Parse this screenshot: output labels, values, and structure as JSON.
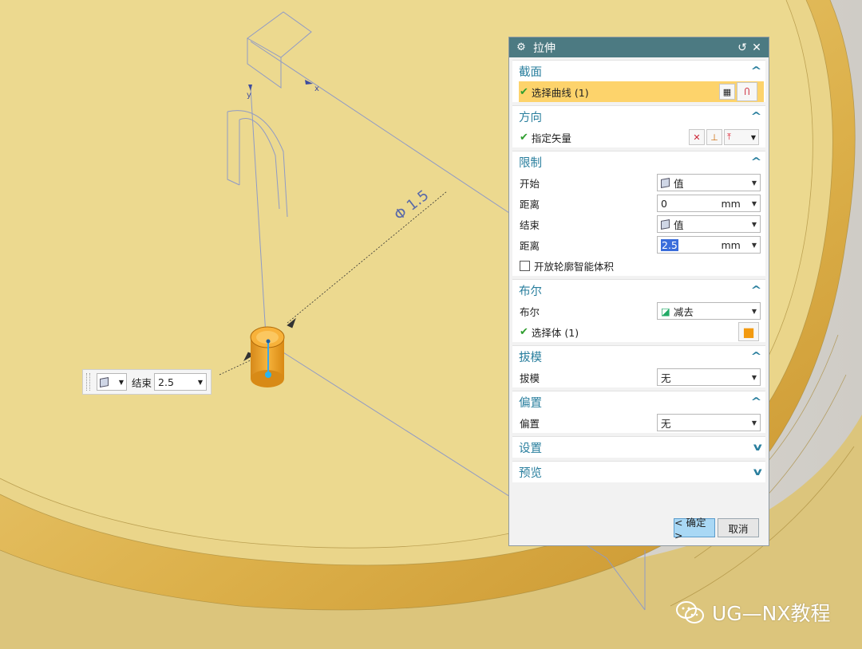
{
  "viewport": {
    "dimension_text": "Φ 1.5",
    "axis_x": "x",
    "axis_y": "y",
    "colors": {
      "part": "#e9cf78",
      "rim": "#d9a83a",
      "highlight": "#f4a321"
    }
  },
  "dialog": {
    "title": "拉伸",
    "title_icon": "gear-icon",
    "reset_glyph": "↺",
    "close_glyph": "✕",
    "groups": {
      "section": {
        "title": "截面",
        "select_curve": "选择曲线 (1)",
        "expanded": true
      },
      "direction": {
        "title": "方向",
        "specify_vector": "指定矢量",
        "expanded": true
      },
      "limits": {
        "title": "限制",
        "start_label": "开始",
        "start_value": "值",
        "distance1_label": "距离",
        "distance1_value": "0",
        "distance1_unit": "mm",
        "end_label": "结束",
        "end_value": "值",
        "distance2_label": "距离",
        "distance2_value": "2.5",
        "distance2_unit": "mm",
        "open_profile_label": "开放轮廓智能体积",
        "open_profile_checked": false,
        "expanded": true
      },
      "boolean": {
        "title": "布尔",
        "boolean_label": "布尔",
        "boolean_value": "减去",
        "select_body": "选择体 (1)",
        "expanded": true
      },
      "draft": {
        "title": "拔模",
        "draft_label": "拔模",
        "draft_value": "无",
        "expanded": true
      },
      "offset": {
        "title": "偏置",
        "offset_label": "偏置",
        "offset_value": "无",
        "expanded": true
      },
      "settings": {
        "title": "设置",
        "expanded": false
      },
      "preview": {
        "title": "预览",
        "expanded": false
      }
    },
    "buttons": {
      "ok": "< 确定 >",
      "cancel": "取消"
    }
  },
  "onscreen_input": {
    "label": "结束",
    "value": "2.5"
  },
  "watermark": {
    "text": "UG—NX教程",
    "icon": "wechat-icon"
  }
}
